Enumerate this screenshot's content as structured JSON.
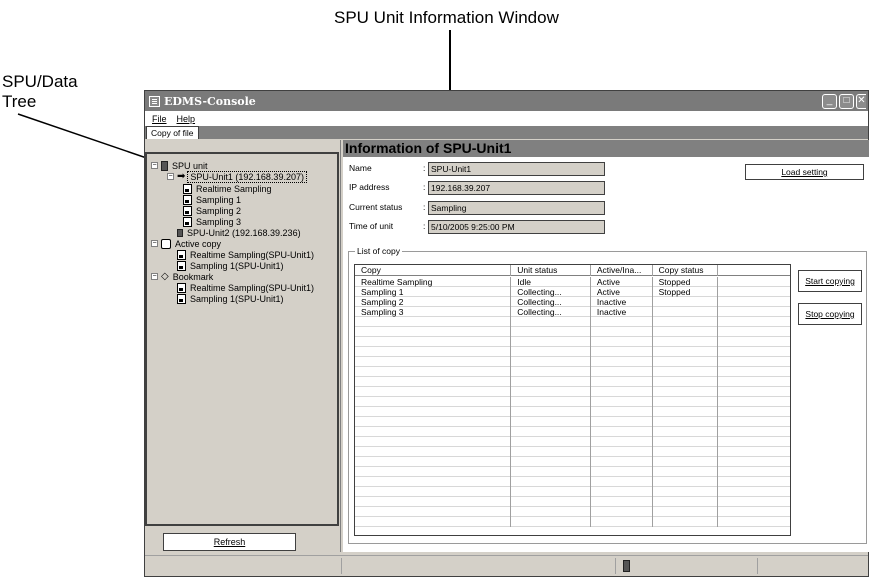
{
  "callouts": {
    "info_window": "SPU Unit Information Window",
    "tree_line1": "SPU/Data",
    "tree_line2": "Tree"
  },
  "window": {
    "title": "EDMS-Console",
    "controls": [
      "minimize-icon",
      "maximize-icon",
      "close-icon"
    ]
  },
  "menu": {
    "file": "File",
    "help": "Help"
  },
  "tab": {
    "label": "Copy of file"
  },
  "tree": {
    "items": [
      {
        "label": "SPU unit",
        "icon": "device-icon",
        "level": 0
      },
      {
        "label": "SPU-Unit1 (192.168.39.207)",
        "icon": "arrow-icon",
        "level": 1,
        "selected": true
      },
      {
        "label": "Realtime Sampling",
        "icon": "sampling-doc-icon",
        "level": 2
      },
      {
        "label": "Sampling 1",
        "icon": "sampling-doc-icon",
        "level": 2
      },
      {
        "label": "Sampling 2",
        "icon": "sampling-doc-icon",
        "level": 2
      },
      {
        "label": "Sampling 3",
        "icon": "sampling-doc-icon",
        "level": 2
      },
      {
        "label": "SPU-Unit2 (192.168.39.236)",
        "icon": "device-icon",
        "level": 1
      },
      {
        "label": "Active copy",
        "icon": "copy-icon",
        "level": 0
      },
      {
        "label": "Realtime Sampling(SPU-Unit1)",
        "icon": "sampling-doc-icon",
        "level": 1
      },
      {
        "label": "Sampling 1(SPU-Unit1)",
        "icon": "sampling-doc-icon",
        "level": 1
      },
      {
        "label": "Bookmark",
        "icon": "bookmark-icon",
        "level": 0
      },
      {
        "label": "Realtime Sampling(SPU-Unit1)",
        "icon": "sampling-doc-icon",
        "level": 1
      },
      {
        "label": "Sampling 1(SPU-Unit1)",
        "icon": "sampling-doc-icon",
        "level": 1
      }
    ],
    "refresh": "Refresh"
  },
  "info": {
    "title": "Information of SPU-Unit1",
    "name_label": "Name",
    "name_value": "SPU-Unit1",
    "ip_label": "IP address",
    "ip_value": "192.168.39.207",
    "status_label": "Current status",
    "status_value": "Sampling",
    "time_label": "Time of unit",
    "time_value": "5/10/2005 9:25:00 PM",
    "colon": ":",
    "load_setting": "Load setting"
  },
  "copy_list": {
    "legend": "List of copy",
    "columns": [
      "Copy",
      "Unit status",
      "Active/Ina...",
      "Copy status",
      ""
    ],
    "rows": [
      [
        "Realtime Sampling",
        "Idle",
        "Active",
        "Stopped",
        ""
      ],
      [
        "Sampling 1",
        "Collecting...",
        "Active",
        "Stopped",
        ""
      ],
      [
        "Sampling 2",
        "Collecting...",
        "Inactive",
        "",
        ""
      ],
      [
        "Sampling 3",
        "Collecting...",
        "Inactive",
        "",
        ""
      ]
    ],
    "start_copying": "Start copying",
    "stop_copying": "Stop copying"
  },
  "colors": {
    "titlebar": "#7a7a7a",
    "panel": "#d4d0c8",
    "header_band": "#808080"
  }
}
